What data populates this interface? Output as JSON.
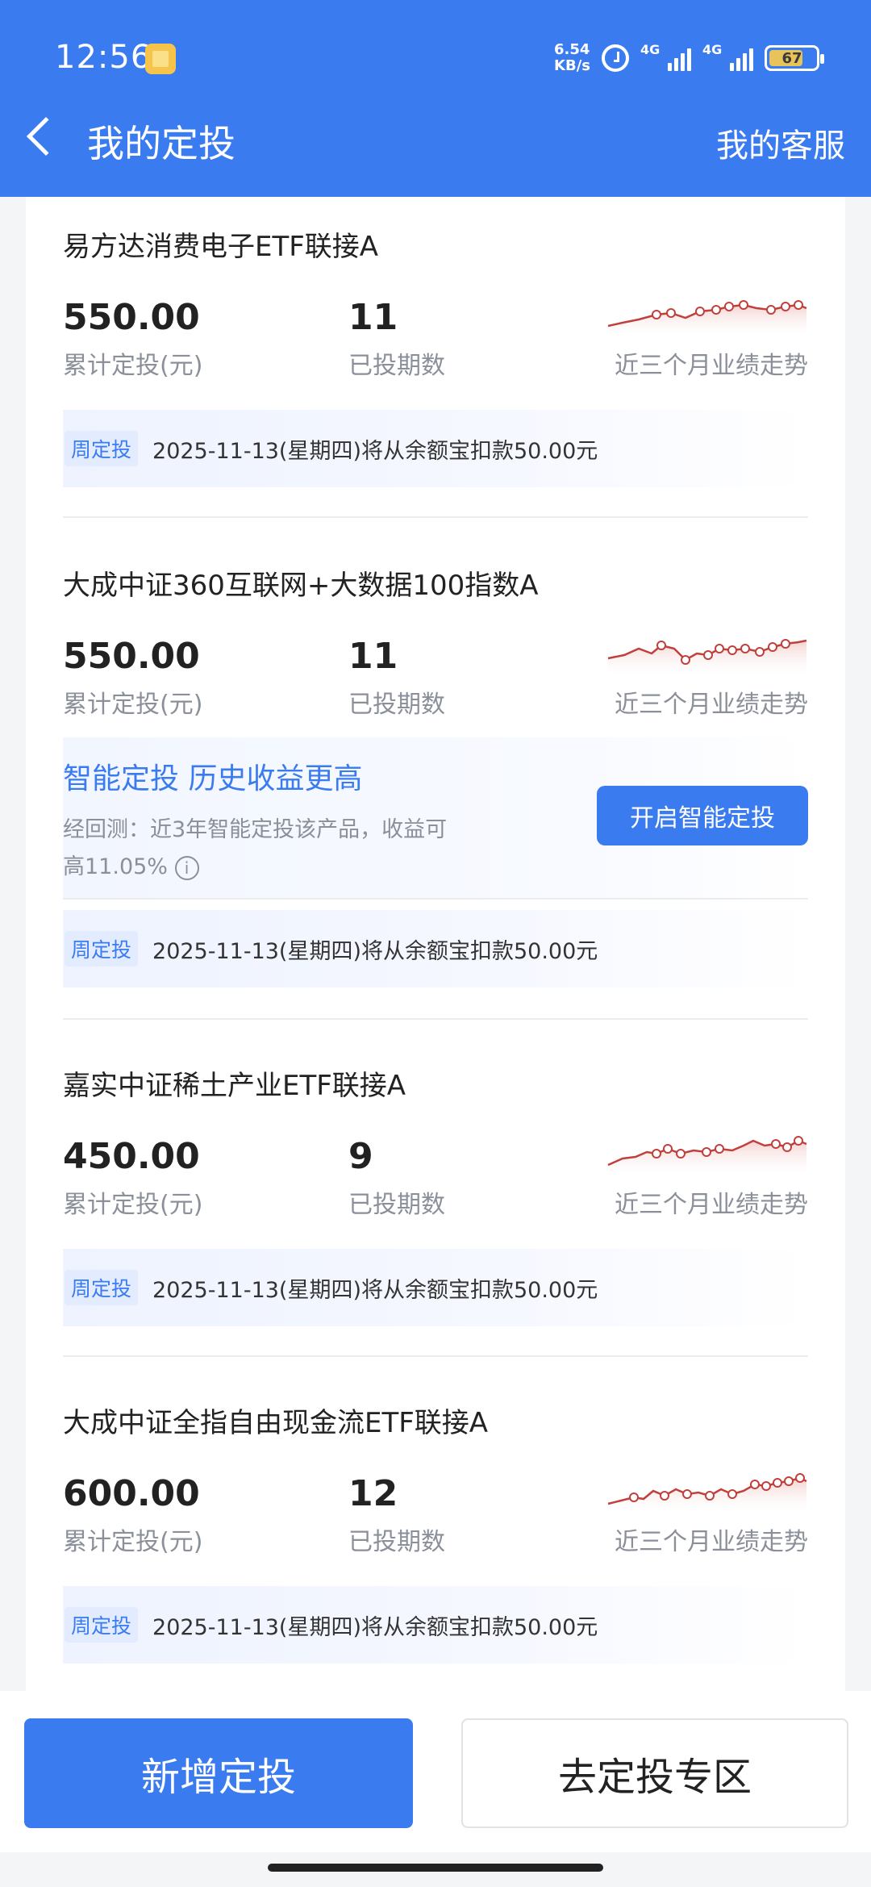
{
  "status_bar": {
    "time": "12:56",
    "net_speed_value": "6.54",
    "net_speed_unit": "KB/s",
    "signal_1": "4G",
    "signal_2": "4G",
    "battery": "67"
  },
  "nav": {
    "title": "我的定投",
    "right_link": "我的客服"
  },
  "labels": {
    "total_invested": "累计定投(元)",
    "periods": "已投期数",
    "trend": "近三个月业绩走势",
    "plan_tag": "周定投"
  },
  "funds": [
    {
      "name": "易方达消费电子ETF联接A",
      "total": "550.00",
      "periods": "11",
      "plan_text": "2025-11-13(星期四)将从余额宝扣款50.00元"
    },
    {
      "name": "大成中证360互联网+大数据100指数A",
      "total": "550.00",
      "periods": "11",
      "plan_text": "2025-11-13(星期四)将从余额宝扣款50.00元"
    },
    {
      "name": "嘉实中证稀土产业ETF联接A",
      "total": "450.00",
      "periods": "9",
      "plan_text": "2025-11-13(星期四)将从余额宝扣款50.00元"
    },
    {
      "name": "大成中证全指自由现金流ETF联接A",
      "total": "600.00",
      "periods": "12",
      "plan_text": "2025-11-13(星期四)将从余额宝扣款50.00元"
    }
  ],
  "smart": {
    "title": "智能定投 历史收益更高",
    "desc_line1": "经回测：近3年智能定投该产品，收益可",
    "desc_line2": "高11.05%",
    "info_glyph": "i",
    "button": "开启智能定投"
  },
  "bottom": {
    "primary": "新增定投",
    "secondary": "去定投专区"
  },
  "colors": {
    "accent": "#3a7bf0",
    "trend_line": "#c0403c"
  }
}
